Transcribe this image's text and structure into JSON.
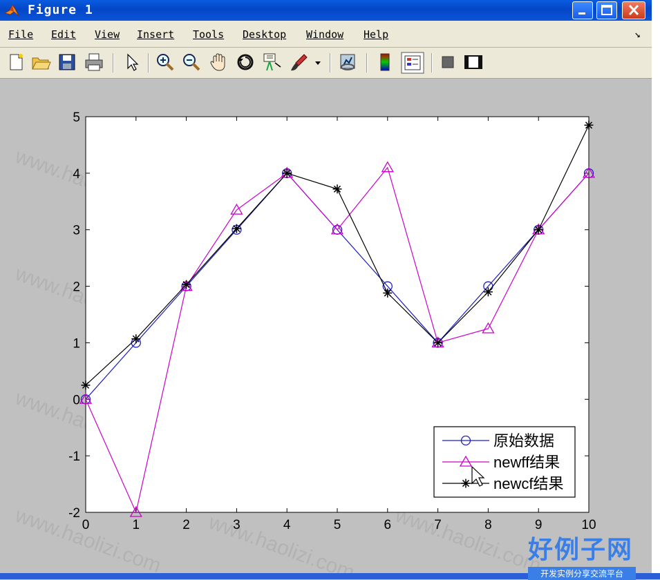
{
  "window": {
    "title": "Figure 1",
    "controls": [
      "minimize",
      "maximize",
      "close"
    ]
  },
  "menu": [
    {
      "label": "File"
    },
    {
      "label": "Edit"
    },
    {
      "label": "View"
    },
    {
      "label": "Insert"
    },
    {
      "label": "Tools"
    },
    {
      "label": "Desktop"
    },
    {
      "label": "Window"
    },
    {
      "label": "Help"
    }
  ],
  "menu_arrow": "↘",
  "toolbar": {
    "icons": [
      "new-figure-icon",
      "open-file-icon",
      "save-icon",
      "print-icon",
      "pointer-icon",
      "zoom-in-icon",
      "zoom-out-icon",
      "pan-hand-icon",
      "rotate-3d-icon",
      "data-cursor-icon",
      "brush-icon",
      "brush-dropdown-icon",
      "link-plot-icon",
      "colorbar-icon",
      "legend-icon",
      "hide-plot-tools-icon",
      "show-plot-tools-icon"
    ]
  },
  "watermark": {
    "text": "www.haolizi.com",
    "logo_main": "好例子网",
    "logo_sub": "开发实例分享交流平台"
  },
  "chart_data": {
    "type": "line",
    "xlim": [
      0,
      10
    ],
    "ylim": [
      -2,
      5
    ],
    "x_ticks": [
      "0",
      "1",
      "2",
      "3",
      "4",
      "5",
      "6",
      "7",
      "8",
      "9",
      "10"
    ],
    "y_ticks": [
      "-2",
      "-1",
      "0",
      "1",
      "2",
      "3",
      "4",
      "5"
    ],
    "series": [
      {
        "name": "原始数据",
        "color": "#1f1fbf",
        "marker": "circle",
        "x": [
          0,
          1,
          2,
          3,
          4,
          5,
          6,
          7,
          8,
          9,
          10
        ],
        "y": [
          0,
          1,
          2,
          3,
          4,
          3,
          2,
          1,
          2,
          3,
          4
        ]
      },
      {
        "name": "newff结果",
        "color": "#cc00cc",
        "marker": "triangle",
        "x": [
          0,
          1,
          2,
          3,
          4,
          5,
          6,
          7,
          8,
          9,
          10
        ],
        "y": [
          0,
          -2,
          2,
          3.35,
          4,
          3,
          4.1,
          1,
          1.25,
          3,
          4
        ]
      },
      {
        "name": "newcf结果",
        "color": "#000000",
        "marker": "star",
        "x": [
          0,
          1,
          2,
          3,
          4,
          5,
          6,
          7,
          8,
          9,
          10
        ],
        "y": [
          0.25,
          1.07,
          2.03,
          3.02,
          4,
          3.72,
          1.88,
          1,
          1.9,
          3,
          4.85
        ]
      }
    ],
    "legend_position": "bottom-right",
    "grid": false
  }
}
